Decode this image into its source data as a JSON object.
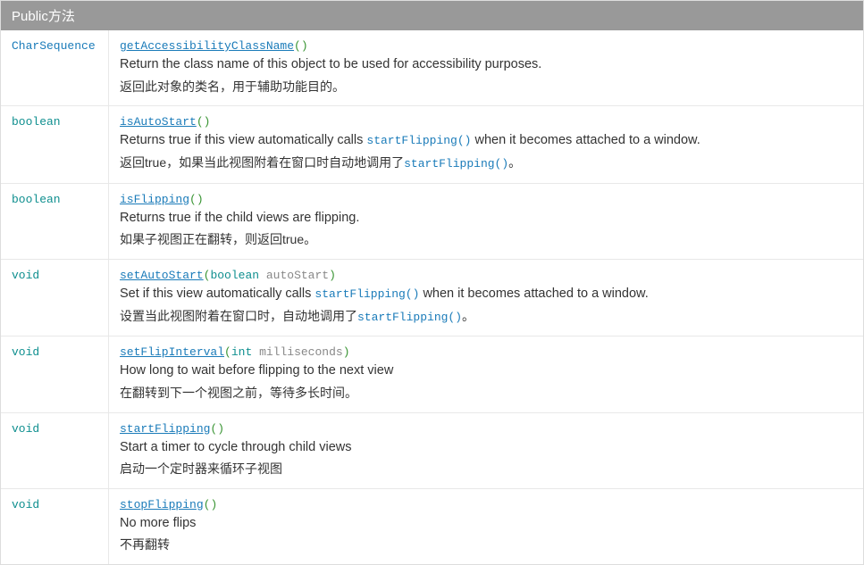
{
  "header": "Public方法",
  "methods": [
    {
      "returnType": "CharSequence",
      "returnIsLink": true,
      "name": "getAccessibilityClassName",
      "params": [],
      "descEn": "Return the class name of this object to be used for accessibility purposes.",
      "descCn": "返回此对象的类名，用于辅助功能目的。",
      "inlineCodeEn": null,
      "inlineCodeCn": null
    },
    {
      "returnType": "boolean",
      "returnIsLink": false,
      "name": "isAutoStart",
      "params": [],
      "descEn": "Returns true if this view automatically calls {CODE} when it becomes attached to a window.",
      "descCn": "返回true，如果当此视图附着在窗口时自动地调用了{CODE}。",
      "inlineCodeEn": "startFlipping()",
      "inlineCodeCn": "startFlipping()"
    },
    {
      "returnType": "boolean",
      "returnIsLink": false,
      "name": "isFlipping",
      "params": [],
      "descEn": "Returns true if the child views are flipping.",
      "descCn": "如果子视图正在翻转，则返回true。",
      "inlineCodeEn": null,
      "inlineCodeCn": null
    },
    {
      "returnType": "void",
      "returnIsLink": false,
      "name": "setAutoStart",
      "params": [
        {
          "type": "boolean",
          "name": "autoStart"
        }
      ],
      "descEn": "Set if this view automatically calls {CODE} when it becomes attached to a window.",
      "descCn": "设置当此视图附着在窗口时，自动地调用了{CODE}。",
      "inlineCodeEn": "startFlipping()",
      "inlineCodeCn": "startFlipping()"
    },
    {
      "returnType": "void",
      "returnIsLink": false,
      "name": "setFlipInterval",
      "params": [
        {
          "type": "int",
          "name": "milliseconds"
        }
      ],
      "descEn": "How long to wait before flipping to the next view",
      "descCn": "在翻转到下一个视图之前，等待多长时间。",
      "inlineCodeEn": null,
      "inlineCodeCn": null
    },
    {
      "returnType": "void",
      "returnIsLink": false,
      "name": "startFlipping",
      "params": [],
      "descEn": "Start a timer to cycle through child views",
      "descCn": "启动一个定时器来循环子视图",
      "inlineCodeEn": null,
      "inlineCodeCn": null
    },
    {
      "returnType": "void",
      "returnIsLink": false,
      "name": "stopFlipping",
      "params": [],
      "descEn": "No more flips",
      "descCn": "不再翻转",
      "inlineCodeEn": null,
      "inlineCodeCn": null
    }
  ]
}
